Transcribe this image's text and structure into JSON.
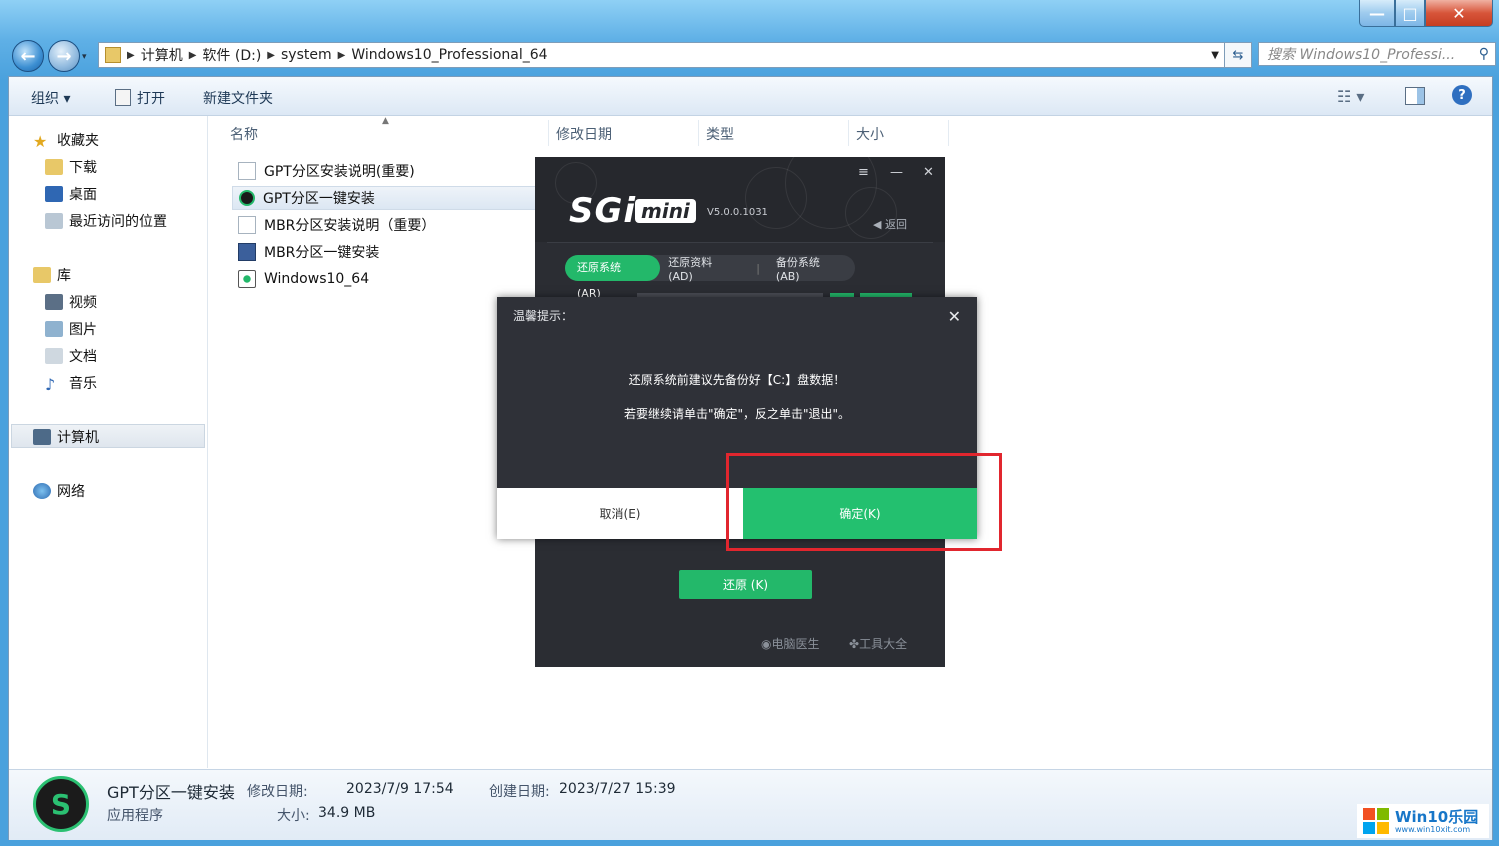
{
  "window": {
    "controls": {
      "minimize": "—",
      "maximize": "□",
      "close": "✕"
    }
  },
  "nav": {
    "back": "←",
    "forward": "→",
    "breadcrumb": [
      "计算机",
      "软件 (D:)",
      "system",
      "Windows10_Professional_64"
    ],
    "search_placeholder": "搜索 Windows10_Professi..."
  },
  "toolbar": {
    "organize": "组织 ▾",
    "open": "打开",
    "new_folder": "新建文件夹",
    "help": "?"
  },
  "sidebar": {
    "favorites": "收藏夹",
    "downloads": "下载",
    "desktop": "桌面",
    "recent": "最近访问的位置",
    "libraries": "库",
    "videos": "视频",
    "pictures": "图片",
    "documents": "文档",
    "music": "音乐",
    "computer": "计算机",
    "network": "网络"
  },
  "columns": {
    "name": "名称",
    "modified": "修改日期",
    "type": "类型",
    "size": "大小"
  },
  "files": [
    {
      "name": "GPT分区安装说明(重要)"
    },
    {
      "name": "GPT分区一键安装"
    },
    {
      "name": "MBR分区安装说明（重要）"
    },
    {
      "name": "MBR分区一键安装"
    },
    {
      "name": "Windows10_64"
    }
  ],
  "details": {
    "name": "GPT分区一键安装",
    "type": "应用程序",
    "modified_label": "修改日期:",
    "modified_value": "2023/7/9 17:54",
    "created_label": "创建日期:",
    "created_value": "2023/7/27 15:39",
    "size_label": "大小:",
    "size_value": "34.9 MB"
  },
  "sgi": {
    "logo": "SGi",
    "mini": "mini",
    "version": "V5.0.0.1031",
    "back": "返回",
    "menu_icon": "≡",
    "min_icon": "—",
    "close_icon": "✕",
    "tabs": [
      "还原系统 (AR)",
      "还原资料 (AD)",
      "备份系统 (AB)"
    ],
    "restore_button": "还原 (K)",
    "footer": [
      "电脑医生",
      "工具大全"
    ]
  },
  "dialog": {
    "title": "温馨提示：",
    "message1": "还原系统前建议先备份好【C:】盘数据！",
    "message2": "若要继续请单击\"确定\"，反之单击\"退出\"。",
    "cancel": "取消(E)",
    "ok": "确定(K)"
  },
  "watermark": {
    "brand": "Win10乐园",
    "url": "www.win10xit.com"
  },
  "colors": {
    "accent_green": "#23c06f",
    "highlight_red": "#e1262e",
    "sgi_bg": "#2b2d33"
  }
}
